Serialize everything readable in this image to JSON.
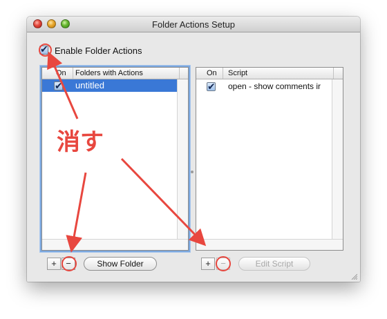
{
  "window": {
    "title": "Folder Actions Setup"
  },
  "enable": {
    "label": "Enable Folder Actions",
    "checked": true
  },
  "folders_table": {
    "columns": [
      "On",
      "Folders with Actions"
    ],
    "rows": [
      {
        "on": true,
        "name": "untitled",
        "selected": true
      }
    ]
  },
  "scripts_table": {
    "columns": [
      "On",
      "Script"
    ],
    "rows": [
      {
        "on": true,
        "name": "open - show comments ir"
      }
    ]
  },
  "left_buttons": {
    "add": "+",
    "remove": "−",
    "show_folder": "Show Folder"
  },
  "right_buttons": {
    "add": "+",
    "remove": "−",
    "edit_script": "Edit Script"
  },
  "annotation": {
    "text": "消す",
    "color": "#e8473f"
  },
  "colors": {
    "selection": "#3a78d6",
    "annotation": "#e8473f",
    "focus_ring": "#7ba7de"
  }
}
